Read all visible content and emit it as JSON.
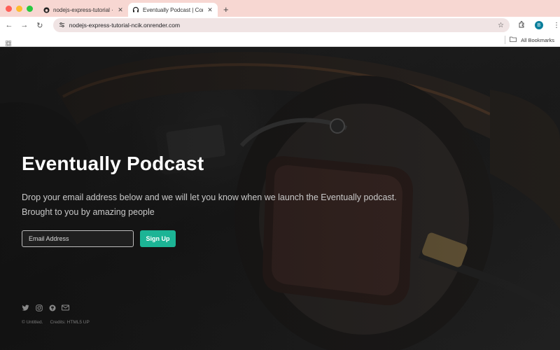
{
  "browser": {
    "tabs": [
      {
        "title": "nodejs-express-tutorial · W",
        "active": false
      },
      {
        "title": "Eventually Podcast | Coming",
        "active": true
      }
    ],
    "url": "nodejs-express-tutorial-ncik.onrender.com",
    "profile_initial": "B",
    "bookmarks_label": "All Bookmarks"
  },
  "hero": {
    "title": "Eventually Podcast",
    "text": "Drop your email address below and we will let you know when we launch the Eventually podcast. Brought to you by amazing people"
  },
  "form": {
    "email_placeholder": "Email Address",
    "signup_label": "Sign Up"
  },
  "social": [
    "twitter-icon",
    "instagram-icon",
    "github-icon",
    "email-icon"
  ],
  "footer": {
    "copyright": "© Untitled.",
    "credits": "Credits: HTML5 UP"
  },
  "colors": {
    "accent": "#1cb495",
    "tabbar": "#f7d7d2"
  }
}
